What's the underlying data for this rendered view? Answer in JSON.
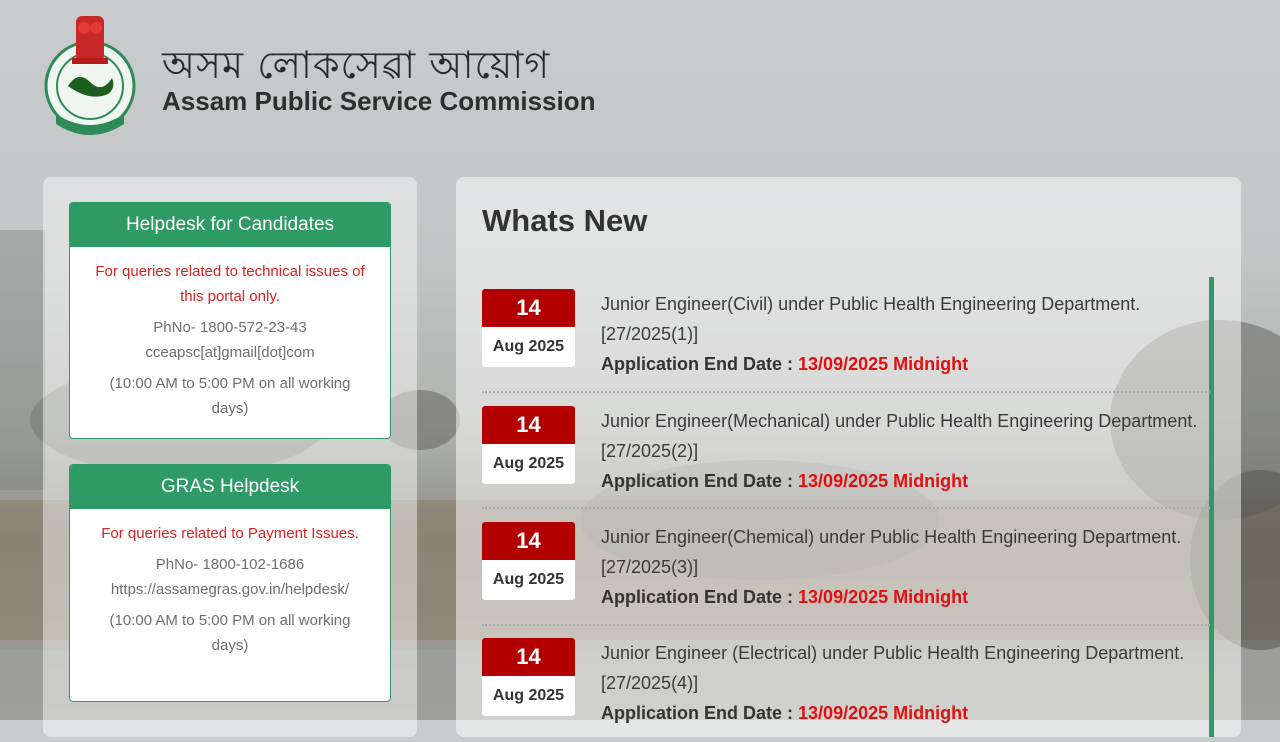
{
  "header": {
    "title_assamese": "অসম লোকসেৱা আয়োগ",
    "title_english": "Assam Public Service Commission",
    "emblem_text": "ASSAM"
  },
  "helpdesk_candidates": {
    "title": "Helpdesk for Candidates",
    "note": "For queries related to technical issues of this portal only.",
    "phone": "PhNo- 1800-572-23-43",
    "email": "cceapsc[at]gmail[dot]com",
    "hours": "(10:00 AM to 5:00 PM on all working days)"
  },
  "gras_helpdesk": {
    "title": "GRAS Helpdesk",
    "note": "For queries related to Payment Issues.",
    "phone": "PhNo- 1800-102-1686",
    "url": "https://assamegras.gov.in/helpdesk/",
    "hours": "(10:00 AM to 5:00 PM on all working days)"
  },
  "whats_new": {
    "title": "Whats New",
    "items": [
      {
        "day": "14",
        "month_year": "Aug 2025",
        "title": "Junior Engineer(Civil) under Public Health Engineering Department. [27/2025(1)]",
        "end_label": "Application End Date :",
        "end_date": "13/09/2025 Midnight"
      },
      {
        "day": "14",
        "month_year": "Aug 2025",
        "title": "Junior Engineer(Mechanical) under Public Health Engineering Department. [27/2025(2)]",
        "end_label": "Application End Date :",
        "end_date": "13/09/2025 Midnight"
      },
      {
        "day": "14",
        "month_year": "Aug 2025",
        "title": "Junior Engineer(Chemical) under Public Health Engineering Department. [27/2025(3)]",
        "end_label": "Application End Date :",
        "end_date": "13/09/2025 Midnight"
      },
      {
        "day": "14",
        "month_year": "Aug 2025",
        "title": "Junior Engineer (Electrical) under Public Health Engineering Department. [27/2025(4)]",
        "end_label": "Application End Date :",
        "end_date": "13/09/2025 Midnight"
      }
    ]
  },
  "colors": {
    "accent_green": "#2e9a66",
    "date_red": "#b30000",
    "alert_red": "#e01010"
  }
}
